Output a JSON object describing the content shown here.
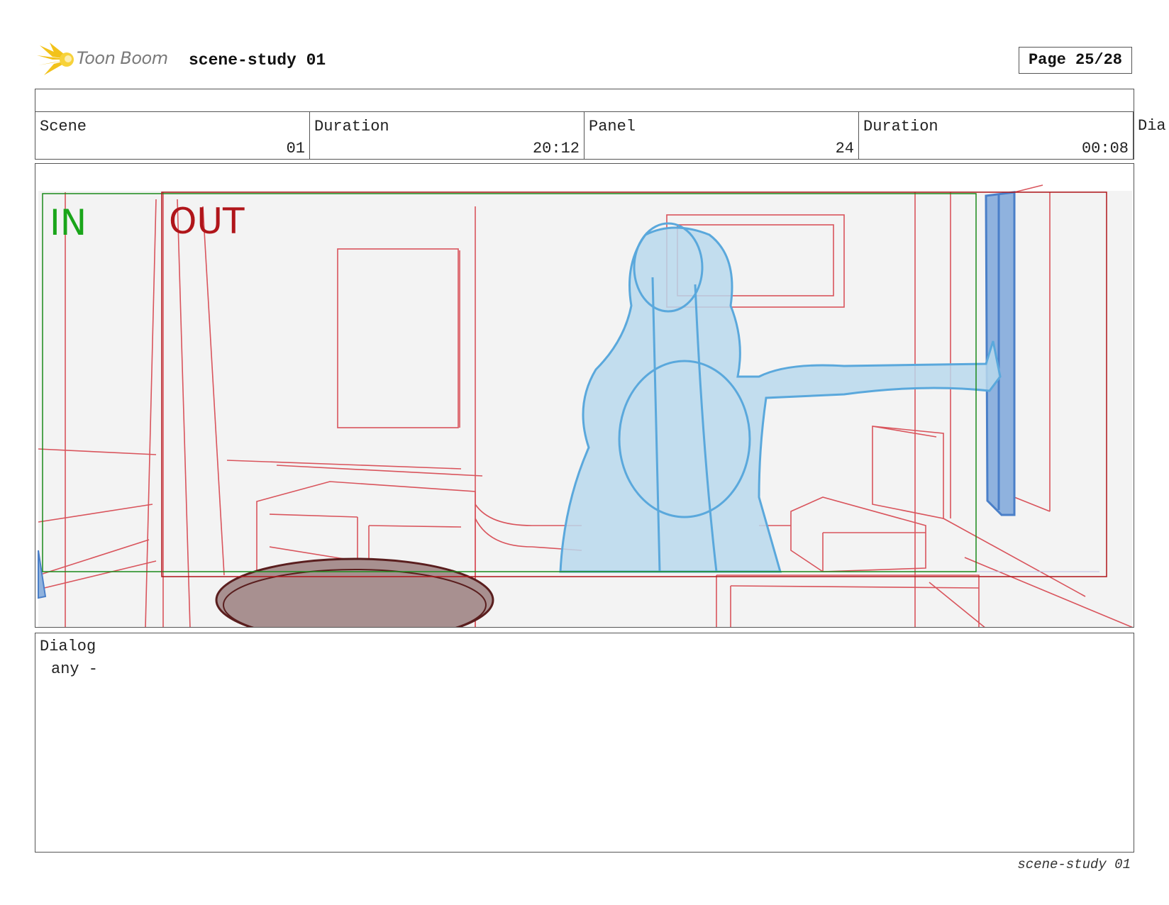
{
  "header": {
    "logo_text": "Toon Boom",
    "title": "scene-study 01",
    "page": "Page 25/28"
  },
  "info": {
    "scene_label": "Scene",
    "scene_value": "01",
    "scene_duration_label": "Duration",
    "scene_duration_value": "20:12",
    "panel_label": "Panel",
    "panel_value": "24",
    "panel_duration_label": "Duration",
    "panel_duration_value": "00:08",
    "overflow_label": "Dia"
  },
  "panel": {
    "in_label": "IN",
    "out_label": "OUT",
    "colors": {
      "in_frame": "#1a8a1a",
      "out_frame": "#b0151a",
      "layout_lines": "#d9545c",
      "character": "#5aa8dc",
      "character_fill": "#b8d8ec",
      "door": "#4a7fc8",
      "door_fill": "#8fb2de",
      "table_fill": "#a89090",
      "table_stroke": "#5a1e1e",
      "background": "#f3f3f3"
    }
  },
  "dialog": {
    "label": "Dialog",
    "text": "any -"
  },
  "footer": {
    "text": "scene-study 01"
  }
}
